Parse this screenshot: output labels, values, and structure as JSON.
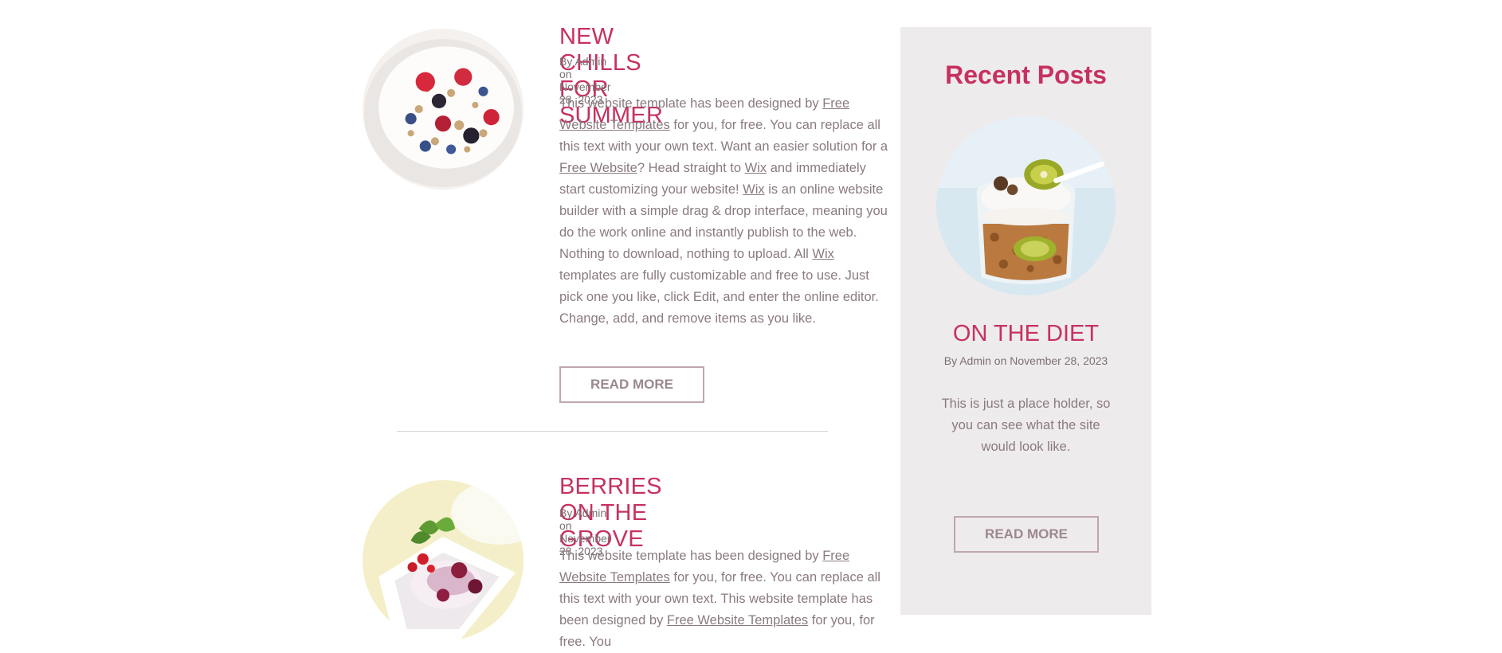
{
  "posts": [
    {
      "title": "NEW CHILLS FOR SUMMER",
      "meta": "By Admin on November 28, 2023",
      "body": [
        {
          "t": "This website template has been designed by "
        },
        {
          "l": "Free Website Templates"
        },
        {
          "t": " for you, for free. You can replace all this text with your own text. Want an easier solution for a "
        },
        {
          "l": "Free Website"
        },
        {
          "t": "? Head straight to "
        },
        {
          "l": "Wix"
        },
        {
          "t": " and immediately start customizing your website! "
        },
        {
          "l": "Wix"
        },
        {
          "t": " is an online website builder with a simple drag & drop interface, meaning you do the work online and instantly publish to the web. Nothing to download, nothing to upload. All "
        },
        {
          "l": "Wix"
        },
        {
          "t": " templates are fully customizable and free to use. Just pick one you like, click Edit, and enter the online editor. Change, add, and remove items as you like."
        }
      ],
      "read_more": "READ MORE",
      "image": "yogurt-berries-granola-bowl"
    },
    {
      "title": "BERRIES ON THE GROVE",
      "meta": "By Admin on November 28, 2023",
      "body": [
        {
          "t": "This website template has been designed by "
        },
        {
          "l": "Free Website Templates"
        },
        {
          "t": " for you, for free. You can replace all this text with your own text. This website template has been designed by "
        },
        {
          "l": "Free Website Templates"
        },
        {
          "t": " for you, for free. You"
        }
      ],
      "image": "berry-cream-dessert-bowl"
    }
  ],
  "sidebar": {
    "heading": "Recent Posts",
    "post_title": "ON THE DIET",
    "post_meta": "By Admin on November 28, 2023",
    "post_body": "This is just a place holder, so you can see what the site would look like.",
    "read_more": "READ MORE",
    "image": "yogurt-kiwi-granola-jar"
  },
  "colors": {
    "accent": "#c7315f",
    "text": "#8a7a7f",
    "sidebar_bg": "#eeebec",
    "button_border": "#bfa6b0"
  }
}
